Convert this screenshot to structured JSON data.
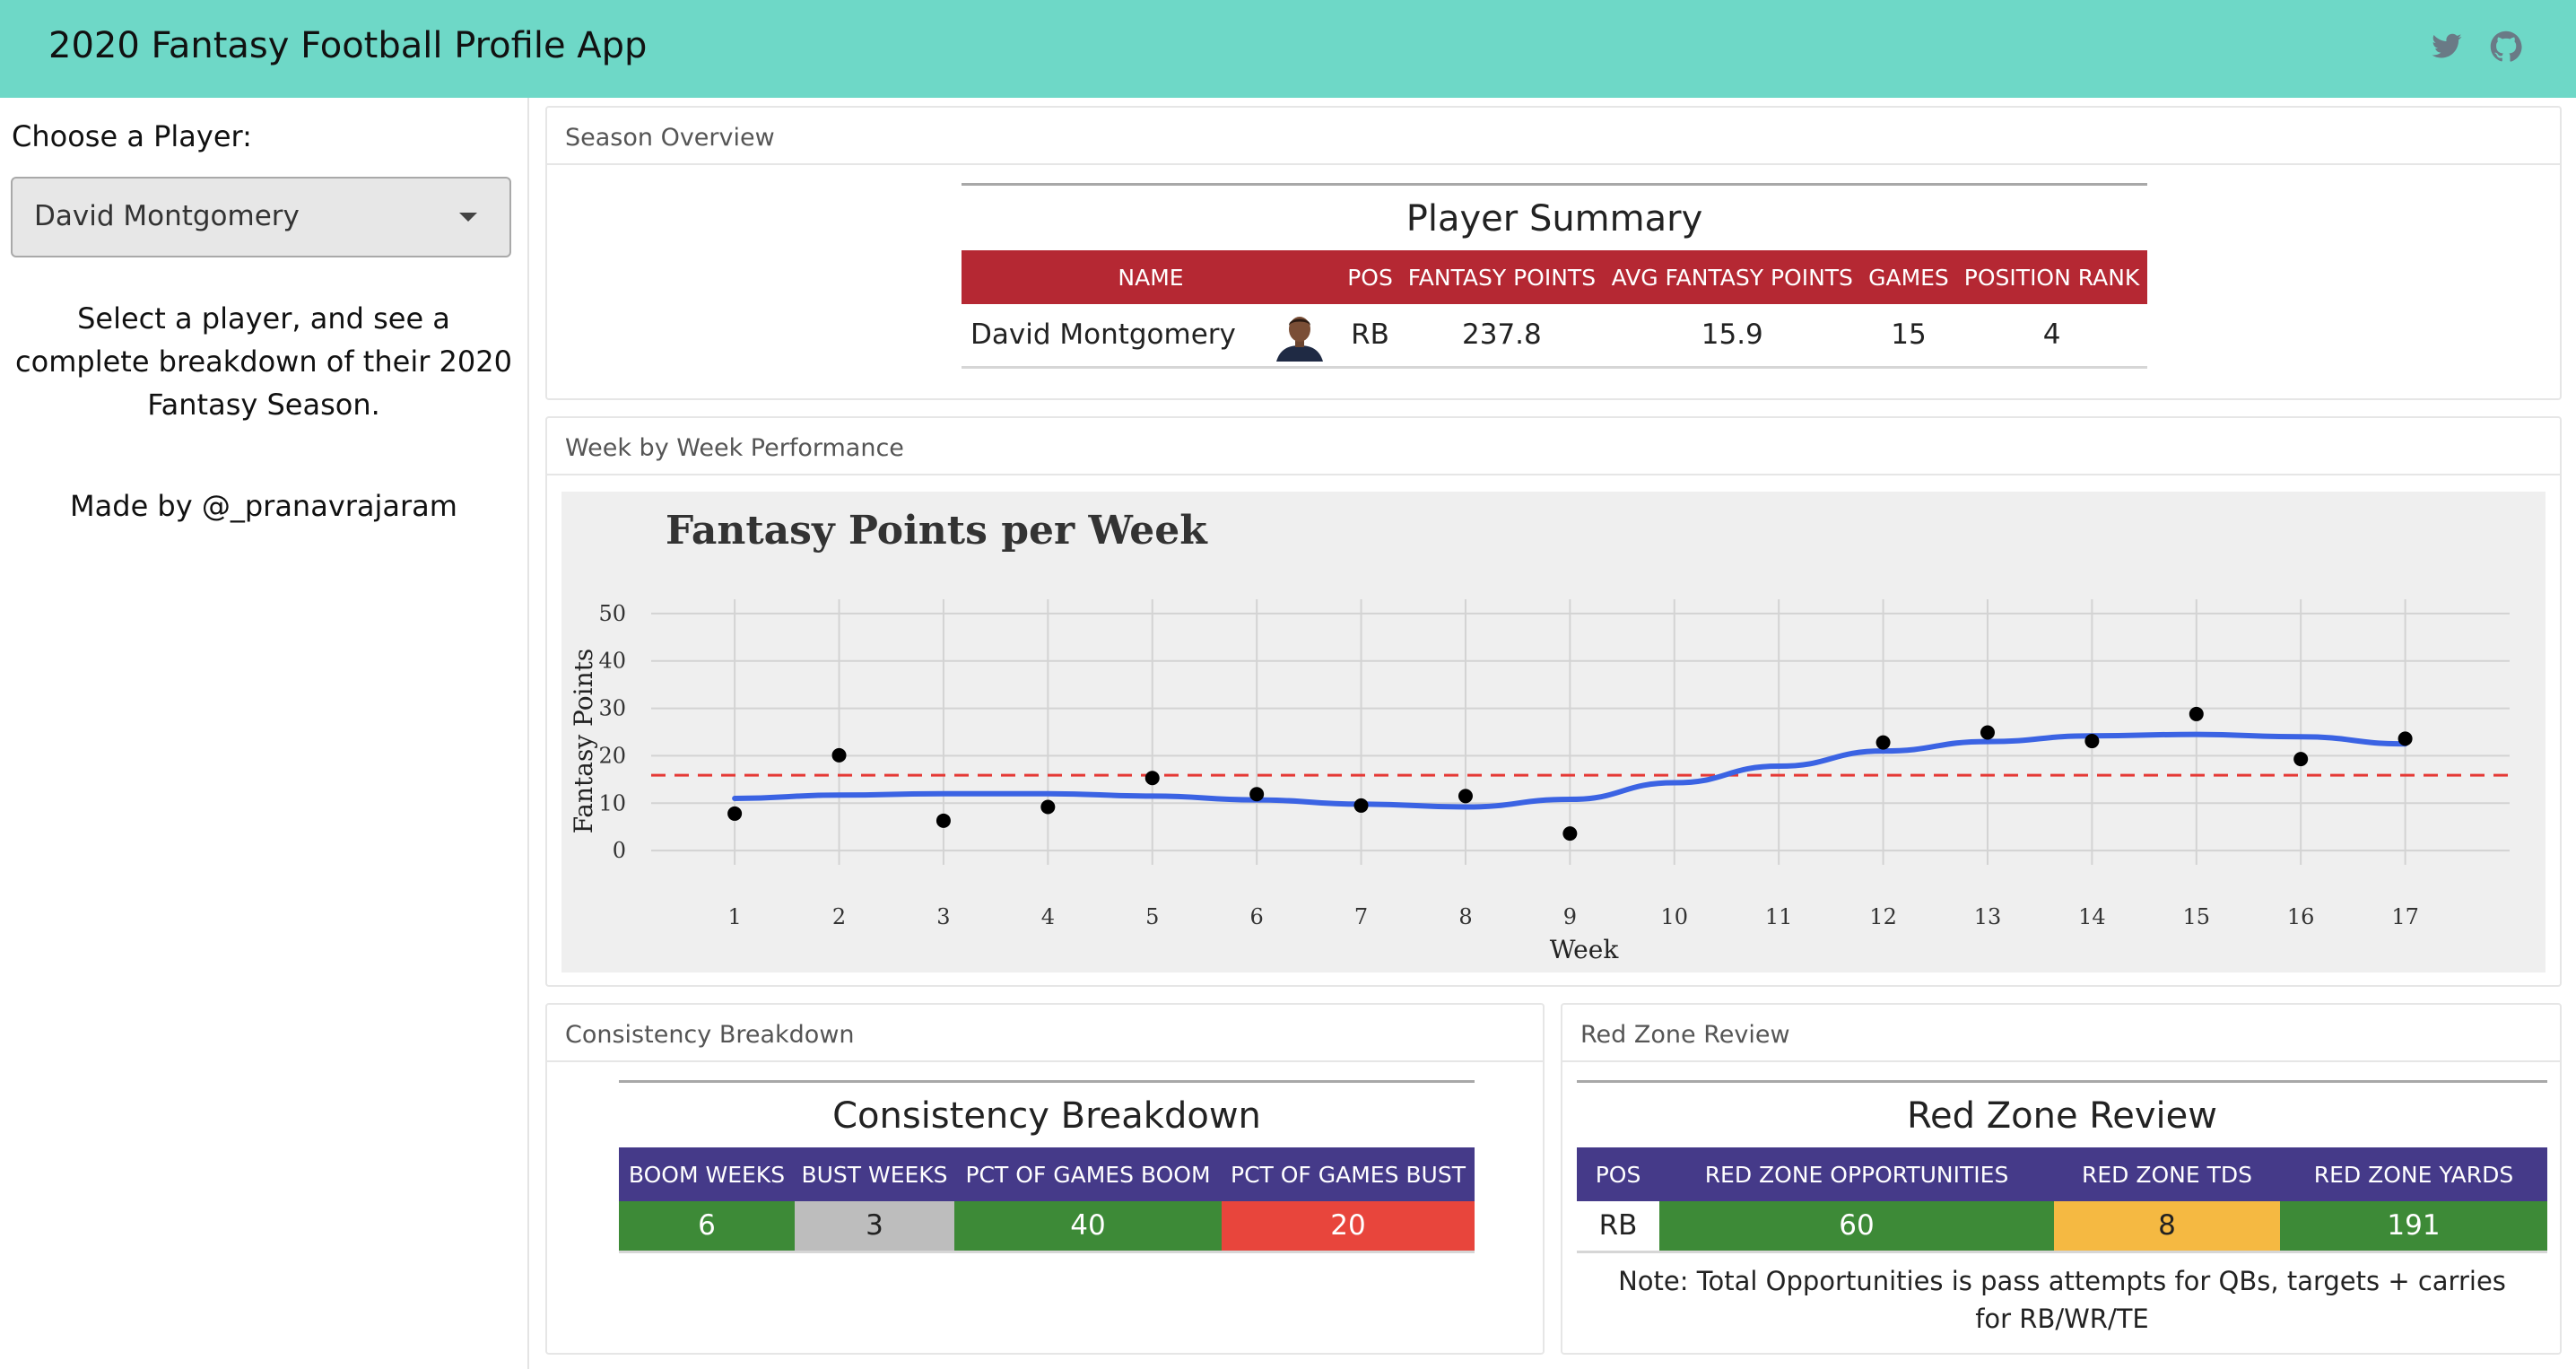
{
  "app": {
    "title": "2020 Fantasy Football Profile App",
    "header_icons": [
      "twitter-icon",
      "github-icon"
    ]
  },
  "sidebar": {
    "choose_label": "Choose a Player:",
    "selected_player": "David Montgomery",
    "description": "Select a player, and see a complete breakdown of their 2020 Fantasy Season.",
    "made_by": "Made by @_pranavrajaram"
  },
  "season_overview": {
    "panel_title": "Season Overview",
    "table_title": "Player Summary",
    "columns": [
      "NAME",
      "POS",
      "FANTASY POINTS",
      "AVG FANTASY POINTS",
      "GAMES",
      "POSITION RANK"
    ],
    "row": {
      "name": "David Montgomery",
      "pos": "RB",
      "fantasy_points": "237.8",
      "avg_fantasy_points": "15.9",
      "games": "15",
      "position_rank": "4"
    },
    "header_color": "#b52833"
  },
  "weekly": {
    "panel_title": "Week by Week Performance"
  },
  "chart_data": {
    "type": "scatter",
    "title": "Fantasy Points per Week",
    "xlabel": "Week",
    "ylabel": "Fantasy Points",
    "x": [
      1,
      2,
      3,
      4,
      5,
      6,
      7,
      8,
      9,
      12,
      13,
      14,
      15,
      16,
      17
    ],
    "y": [
      7.8,
      20.1,
      6.3,
      9.2,
      15.3,
      11.9,
      9.5,
      11.5,
      3.6,
      22.8,
      24.9,
      23.1,
      28.8,
      19.3,
      23.6
    ],
    "x_ticks": [
      1,
      2,
      3,
      4,
      5,
      6,
      7,
      8,
      9,
      10,
      11,
      12,
      13,
      14,
      15,
      16,
      17
    ],
    "y_ticks": [
      0,
      10,
      20,
      30,
      40,
      50
    ],
    "xlim": [
      0.2,
      18
    ],
    "ylim": [
      -3,
      53
    ],
    "average_line": 15.9,
    "average_line_color": "#e53935",
    "smooth_line": {
      "x": [
        1,
        2,
        3,
        4,
        5,
        6,
        7,
        8,
        9,
        10,
        11,
        12,
        13,
        14,
        15,
        16,
        17
      ],
      "y": [
        11.0,
        11.7,
        12.0,
        12.0,
        11.5,
        10.7,
        9.8,
        9.2,
        10.8,
        14.3,
        17.8,
        21.0,
        23.0,
        24.2,
        24.5,
        24.0,
        22.5
      ]
    },
    "smooth_line_color": "#3b63e3",
    "grid": true
  },
  "consistency": {
    "panel_title": "Consistency Breakdown",
    "table_title": "Consistency Breakdown",
    "columns": [
      "BOOM WEEKS",
      "BUST WEEKS",
      "PCT OF GAMES BOOM",
      "PCT OF GAMES BUST"
    ],
    "values": [
      "6",
      "3",
      "40",
      "20"
    ],
    "cell_colors": [
      "#3d8a37",
      "#bdbdbd",
      "#3d8a37",
      "#e8453c"
    ],
    "text_colors": [
      "#ffffff",
      "#222222",
      "#ffffff",
      "#ffffff"
    ],
    "header_color": "#453a89"
  },
  "red_zone": {
    "panel_title": "Red Zone Review",
    "table_title": "Red Zone Review",
    "columns": [
      "POS",
      "RED ZONE OPPORTUNITIES",
      "RED ZONE TDS",
      "RED ZONE YARDS"
    ],
    "values": [
      "RB",
      "60",
      "8",
      "191"
    ],
    "cell_colors": [
      "#ffffff",
      "#3d8a37",
      "#f5b942",
      "#3d8a37"
    ],
    "text_colors": [
      "#222222",
      "#ffffff",
      "#222222",
      "#ffffff"
    ],
    "note": "Note: Total Opportunities is pass attempts for QBs, targets + carries for RB/WR/TE",
    "header_color": "#453a89"
  }
}
